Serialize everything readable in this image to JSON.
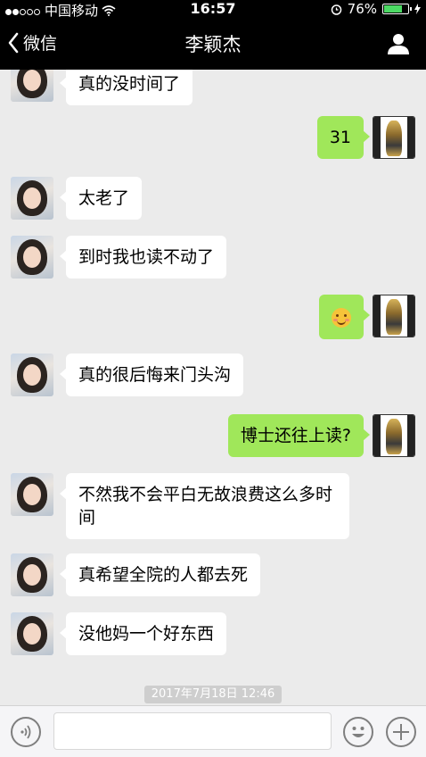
{
  "status_bar": {
    "carrier": "中国移动",
    "time": "16:57",
    "battery_percent": "76%",
    "battery_level": 0.76,
    "icons": [
      "signal-dots-icon",
      "wifi-icon",
      "alarm-clock-icon",
      "battery-icon",
      "charging-icon"
    ]
  },
  "nav": {
    "back_label": "微信",
    "title": "李颖杰",
    "profile_icon": "person-icon"
  },
  "messages": [
    {
      "sender": "her",
      "text": "真的没时间了"
    },
    {
      "sender": "me",
      "text": "31"
    },
    {
      "sender": "her",
      "text": "太老了"
    },
    {
      "sender": "her",
      "text": "到时我也读不动了"
    },
    {
      "sender": "me",
      "text": "",
      "emoji": "blushing-smile-emoji"
    },
    {
      "sender": "her",
      "text": "真的很后悔来门头沟"
    },
    {
      "sender": "me",
      "text": "博士还往上读?"
    },
    {
      "sender": "her",
      "text_lines": [
        "不然我不会平白无故浪费这么多时",
        "间"
      ]
    },
    {
      "sender": "her",
      "text": "真希望全院的人都去死"
    },
    {
      "sender": "her",
      "text": "没他妈一个好东西"
    }
  ],
  "timestamp": "2017年7月18日 12:46",
  "input_bar": {
    "voice_icon": "voice-icon",
    "input_value": "",
    "emoji_icon": "emoji-face-icon",
    "plus_icon": "plus-icon"
  },
  "colors": {
    "background": "#ebebeb",
    "nav_background": "#000000",
    "my_bubble": "#a0e75a",
    "her_bubble": "#ffffff",
    "battery_fill": "#4cd964"
  }
}
